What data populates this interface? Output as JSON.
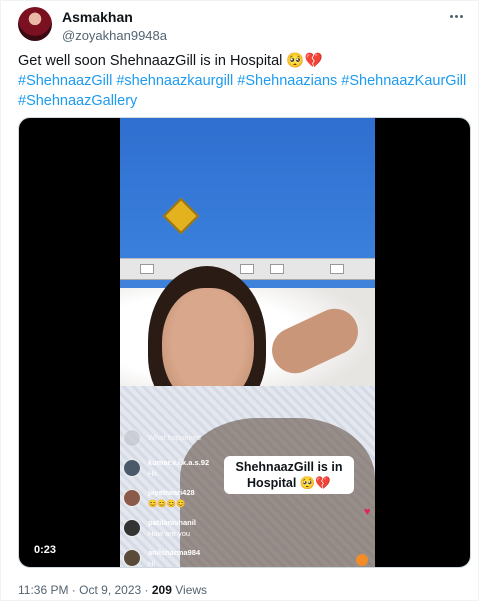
{
  "author": {
    "display_name": "Asmakhan",
    "handle": "@zoyakhan9948a"
  },
  "tweet": {
    "text_prefix": "Get well soon ShehnaazGill is in Hospital 🥺💔",
    "hashtags": [
      "#ShehnaazGill",
      "#shehnaazkaurgill",
      "#Shehnaazians",
      "#ShehnaazKaurGill",
      "#ShehnaazGallery"
    ]
  },
  "video": {
    "duration": "0:23",
    "overlay_caption_line1": "ShehnaazGill is in",
    "overlay_caption_line2": "Hospital 🥺💔",
    "live_comments": [
      {
        "user": "",
        "message": "What happened"
      },
      {
        "user": "kumar.v.i.k.a.s.92",
        "message": "Hii"
      },
      {
        "user": "jayatiwari428",
        "message": "😊😊😊😊"
      },
      {
        "user": "patilanishanil",
        "message": "How are you"
      },
      {
        "user": "anilsharma984",
        "message": "Hi"
      }
    ]
  },
  "meta": {
    "timestamp": "11:36 PM · Oct 9, 2023 ·",
    "views_count": "209",
    "views_label": "Views"
  }
}
